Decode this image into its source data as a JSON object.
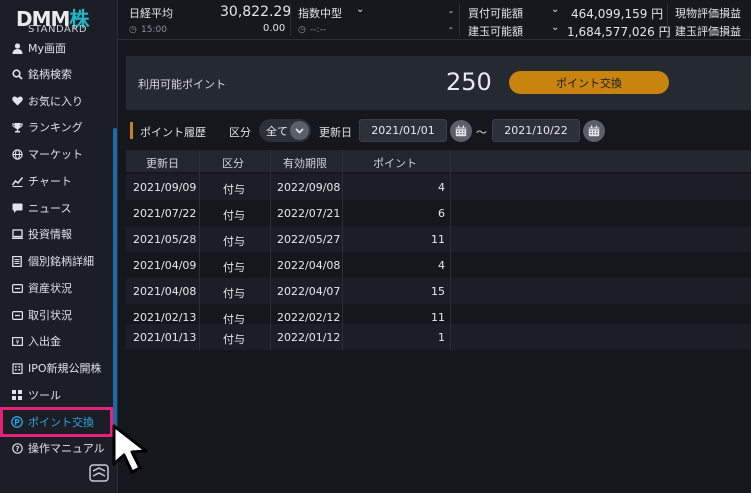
{
  "logo": {
    "brand": "DMM",
    "kabu": "株",
    "edition": "STANDARD"
  },
  "sidebar": {
    "items": [
      {
        "label": "My画面",
        "icon": "person-icon"
      },
      {
        "label": "銘柄検索",
        "icon": "search-icon"
      },
      {
        "label": "お気に入り",
        "icon": "heart-icon"
      },
      {
        "label": "ランキング",
        "icon": "trophy-icon"
      },
      {
        "label": "マーケット",
        "icon": "globe-icon"
      },
      {
        "label": "チャート",
        "icon": "chart-icon"
      },
      {
        "label": "ニュース",
        "icon": "chat-icon"
      },
      {
        "label": "投資情報",
        "icon": "monitor-icon"
      },
      {
        "label": "個別銘柄詳細",
        "icon": "document-icon"
      },
      {
        "label": "資産状況",
        "icon": "wallet-icon"
      },
      {
        "label": "取引状況",
        "icon": "list-icon"
      },
      {
        "label": "入出金",
        "icon": "money-icon"
      },
      {
        "label": "IPO新規公開株",
        "icon": "building-icon"
      },
      {
        "label": "ツール",
        "icon": "grid-icon"
      },
      {
        "label": "ポイント交換",
        "icon": "point-icon",
        "active": true
      },
      {
        "label": "操作マニュアル",
        "icon": "help-icon"
      }
    ]
  },
  "ticker": {
    "index1_name": "日経平均",
    "index1_value": "30,822.29",
    "index1_time": "15:00",
    "index1_change": "0.00",
    "index2_name": "指数中型",
    "index2_value": "-",
    "index2_time": "--:--",
    "index2_change": "-",
    "buying_power_label": "買付可能額",
    "buying_power_value": "464,099,159 円",
    "margin_label": "建玉可能額",
    "margin_value": "1,684,577,026 円",
    "spot_pl_label": "現物評価損益",
    "margin_pl_label": "建玉評価損益"
  },
  "points": {
    "label": "利用可能ポイント",
    "value": "250",
    "exchange_button": "ポイント交換"
  },
  "filter": {
    "history_title": "ポイント履歴",
    "category_label": "区分",
    "category_value": "全て",
    "date_label": "更新日",
    "date_from": "2021/01/01",
    "tilde": "〜",
    "date_to": "2021/10/22"
  },
  "table": {
    "headers": [
      "更新日",
      "区分",
      "有効期限",
      "ポイント"
    ],
    "rows": [
      {
        "date": "2021/09/09",
        "type": "付与",
        "expiry": "2022/09/08",
        "points": "4"
      },
      {
        "date": "2021/07/22",
        "type": "付与",
        "expiry": "2022/07/21",
        "points": "6"
      },
      {
        "date": "2021/05/28",
        "type": "付与",
        "expiry": "2022/05/27",
        "points": "11"
      },
      {
        "date": "2021/04/09",
        "type": "付与",
        "expiry": "2022/04/08",
        "points": "4"
      },
      {
        "date": "2021/04/08",
        "type": "付与",
        "expiry": "2022/04/07",
        "points": "15"
      },
      {
        "date": "2021/02/13",
        "type": "付与",
        "expiry": "2022/02/12",
        "points": "11"
      },
      {
        "date": "2021/01/13",
        "type": "付与",
        "expiry": "2022/01/12",
        "points": "1"
      }
    ]
  },
  "colors": {
    "accent_orange": "#c8840f",
    "highlight_pink": "#e6217a",
    "active_blue": "#2ea3e3",
    "brand_teal": "#1fb7c8"
  }
}
